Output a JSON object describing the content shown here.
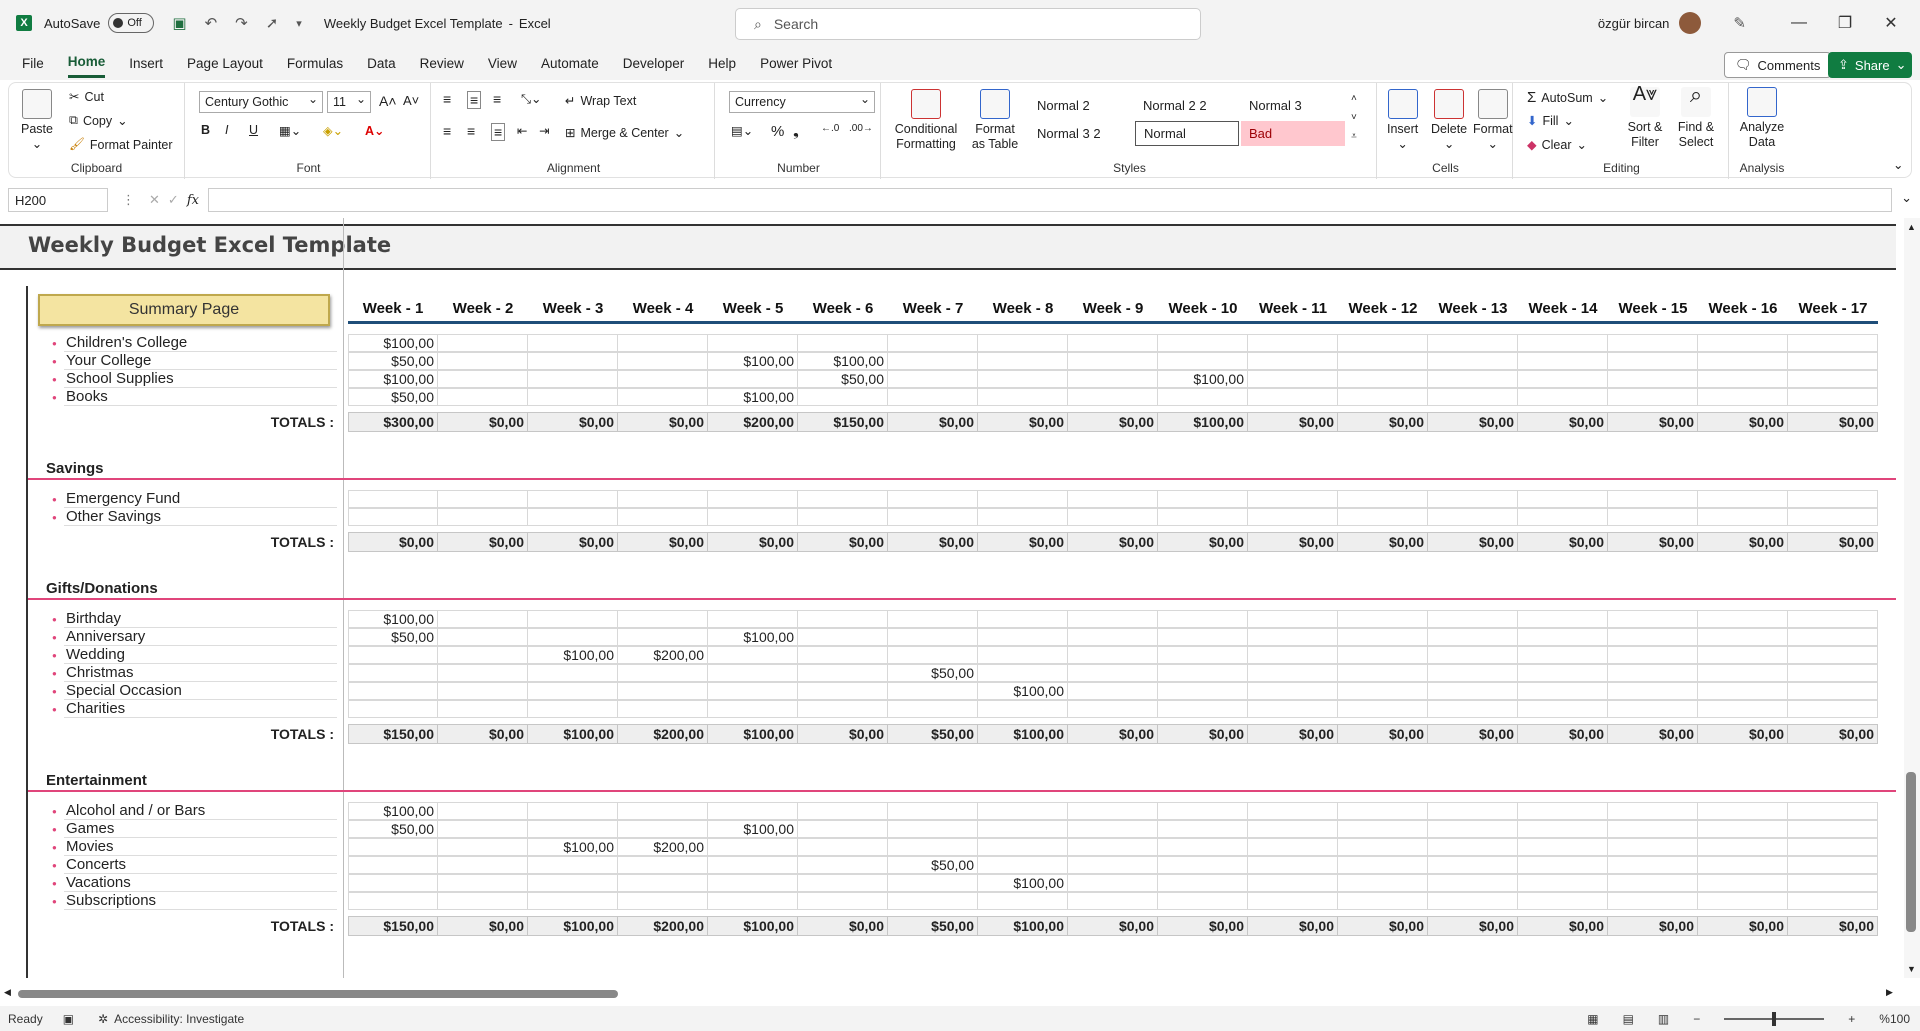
{
  "window": {
    "autosave_label": "AutoSave",
    "autosave_state": "Off",
    "doc_title": "Weekly Budget Excel Template",
    "app_name": "Excel",
    "search_placeholder": "Search",
    "user_name": "özgür bircan"
  },
  "menu": {
    "tabs": [
      "File",
      "Home",
      "Insert",
      "Page Layout",
      "Formulas",
      "Data",
      "Review",
      "View",
      "Automate",
      "Developer",
      "Help",
      "Power Pivot"
    ],
    "active": "Home",
    "comments_label": "Comments",
    "share_label": "Share"
  },
  "ribbon": {
    "clipboard": {
      "paste": "Paste",
      "cut": "Cut",
      "copy": "Copy",
      "format_painter": "Format Painter",
      "label": "Clipboard"
    },
    "font": {
      "name": "Century Gothic",
      "size": "11",
      "bold": "B",
      "italic": "I",
      "underline": "U",
      "label": "Font"
    },
    "alignment": {
      "wrap": "Wrap Text",
      "merge": "Merge & Center",
      "label": "Alignment"
    },
    "number": {
      "format": "Currency",
      "label": "Number"
    },
    "styles": {
      "conditional": "Conditional Formatting",
      "format_table": "Format as Table",
      "cells": [
        "Normal 2",
        "Normal 2 2",
        "Normal 3",
        "Normal 3 2",
        "Normal",
        "Bad"
      ],
      "label": "Styles"
    },
    "cells": {
      "insert": "Insert",
      "delete": "Delete",
      "format": "Format",
      "label": "Cells"
    },
    "editing": {
      "autosum": "AutoSum",
      "fill": "Fill",
      "clear": "Clear",
      "sort": "Sort & Filter",
      "find": "Find & Select",
      "label": "Editing"
    },
    "analysis": {
      "analyze": "Analyze Data",
      "label": "Analysis"
    }
  },
  "formula_bar": {
    "name_box": "H200",
    "fx": "fx",
    "value": ""
  },
  "sheet": {
    "title": "Weekly Budget Excel Template",
    "summary_button": "Summary Page",
    "weeks": [
      "Week - 1",
      "Week - 2",
      "Week - 3",
      "Week - 4",
      "Week - 5",
      "Week - 6",
      "Week - 7",
      "Week - 8",
      "Week - 9",
      "Week - 10",
      "Week - 11",
      "Week - 12",
      "Week - 13",
      "Week - 14",
      "Week - 15",
      "Week - 16",
      "Week - 17"
    ],
    "totals_label": "TOTALS :",
    "sections": [
      {
        "name": "",
        "rows": [
          {
            "label": "Children's College",
            "values": [
              "$100,00",
              "",
              "",
              "",
              "",
              "",
              "",
              "",
              "",
              "",
              "",
              "",
              "",
              "",
              "",
              "",
              ""
            ]
          },
          {
            "label": "Your College",
            "values": [
              "$50,00",
              "",
              "",
              "",
              "$100,00",
              "$100,00",
              "",
              "",
              "",
              "",
              "",
              "",
              "",
              "",
              "",
              "",
              ""
            ]
          },
          {
            "label": "School Supplies",
            "values": [
              "$100,00",
              "",
              "",
              "",
              "",
              "$50,00",
              "",
              "",
              "",
              "$100,00",
              "",
              "",
              "",
              "",
              "",
              "",
              ""
            ]
          },
          {
            "label": "Books",
            "values": [
              "$50,00",
              "",
              "",
              "",
              "$100,00",
              "",
              "",
              "",
              "",
              "",
              "",
              "",
              "",
              "",
              "",
              "",
              ""
            ]
          }
        ],
        "totals": [
          "$300,00",
          "$0,00",
          "$0,00",
          "$0,00",
          "$200,00",
          "$150,00",
          "$0,00",
          "$0,00",
          "$0,00",
          "$100,00",
          "$0,00",
          "$0,00",
          "$0,00",
          "$0,00",
          "$0,00",
          "$0,00",
          "$0,00"
        ]
      },
      {
        "name": "Savings",
        "rows": [
          {
            "label": "Emergency Fund",
            "values": [
              "",
              "",
              "",
              "",
              "",
              "",
              "",
              "",
              "",
              "",
              "",
              "",
              "",
              "",
              "",
              "",
              ""
            ]
          },
          {
            "label": "Other Savings",
            "values": [
              "",
              "",
              "",
              "",
              "",
              "",
              "",
              "",
              "",
              "",
              "",
              "",
              "",
              "",
              "",
              "",
              ""
            ]
          }
        ],
        "totals": [
          "$0,00",
          "$0,00",
          "$0,00",
          "$0,00",
          "$0,00",
          "$0,00",
          "$0,00",
          "$0,00",
          "$0,00",
          "$0,00",
          "$0,00",
          "$0,00",
          "$0,00",
          "$0,00",
          "$0,00",
          "$0,00",
          "$0,00"
        ]
      },
      {
        "name": "Gifts/Donations",
        "rows": [
          {
            "label": "Birthday",
            "values": [
              "$100,00",
              "",
              "",
              "",
              "",
              "",
              "",
              "",
              "",
              "",
              "",
              "",
              "",
              "",
              "",
              "",
              ""
            ]
          },
          {
            "label": "Anniversary",
            "values": [
              "$50,00",
              "",
              "",
              "",
              "$100,00",
              "",
              "",
              "",
              "",
              "",
              "",
              "",
              "",
              "",
              "",
              "",
              ""
            ]
          },
          {
            "label": "Wedding",
            "values": [
              "",
              "",
              "$100,00",
              "$200,00",
              "",
              "",
              "",
              "",
              "",
              "",
              "",
              "",
              "",
              "",
              "",
              "",
              ""
            ]
          },
          {
            "label": "Christmas",
            "values": [
              "",
              "",
              "",
              "",
              "",
              "",
              "$50,00",
              "",
              "",
              "",
              "",
              "",
              "",
              "",
              "",
              "",
              ""
            ]
          },
          {
            "label": "Special Occasion",
            "values": [
              "",
              "",
              "",
              "",
              "",
              "",
              "",
              "$100,00",
              "",
              "",
              "",
              "",
              "",
              "",
              "",
              "",
              ""
            ]
          },
          {
            "label": "Charities",
            "values": [
              "",
              "",
              "",
              "",
              "",
              "",
              "",
              "",
              "",
              "",
              "",
              "",
              "",
              "",
              "",
              "",
              ""
            ]
          }
        ],
        "totals": [
          "$150,00",
          "$0,00",
          "$100,00",
          "$200,00",
          "$100,00",
          "$0,00",
          "$50,00",
          "$100,00",
          "$0,00",
          "$0,00",
          "$0,00",
          "$0,00",
          "$0,00",
          "$0,00",
          "$0,00",
          "$0,00",
          "$0,00"
        ]
      },
      {
        "name": "Entertainment",
        "rows": [
          {
            "label": "Alcohol and / or Bars",
            "values": [
              "$100,00",
              "",
              "",
              "",
              "",
              "",
              "",
              "",
              "",
              "",
              "",
              "",
              "",
              "",
              "",
              "",
              ""
            ]
          },
          {
            "label": "Games",
            "values": [
              "$50,00",
              "",
              "",
              "",
              "$100,00",
              "",
              "",
              "",
              "",
              "",
              "",
              "",
              "",
              "",
              "",
              "",
              ""
            ]
          },
          {
            "label": "Movies",
            "values": [
              "",
              "",
              "$100,00",
              "$200,00",
              "",
              "",
              "",
              "",
              "",
              "",
              "",
              "",
              "",
              "",
              "",
              "",
              ""
            ]
          },
          {
            "label": "Concerts",
            "values": [
              "",
              "",
              "",
              "",
              "",
              "",
              "$50,00",
              "",
              "",
              "",
              "",
              "",
              "",
              "",
              "",
              "",
              ""
            ]
          },
          {
            "label": "Vacations",
            "values": [
              "",
              "",
              "",
              "",
              "",
              "",
              "",
              "$100,00",
              "",
              "",
              "",
              "",
              "",
              "",
              "",
              "",
              ""
            ]
          },
          {
            "label": "Subscriptions",
            "values": [
              "",
              "",
              "",
              "",
              "",
              "",
              "",
              "",
              "",
              "",
              "",
              "",
              "",
              "",
              "",
              "",
              ""
            ]
          }
        ],
        "totals": [
          "$150,00",
          "$0,00",
          "$100,00",
          "$200,00",
          "$100,00",
          "$0,00",
          "$50,00",
          "$100,00",
          "$0,00",
          "$0,00",
          "$0,00",
          "$0,00",
          "$0,00",
          "$0,00",
          "$0,00",
          "$0,00",
          "$0,00"
        ]
      }
    ]
  },
  "status": {
    "ready": "Ready",
    "accessibility": "Accessibility: Investigate",
    "zoom": "%100"
  }
}
